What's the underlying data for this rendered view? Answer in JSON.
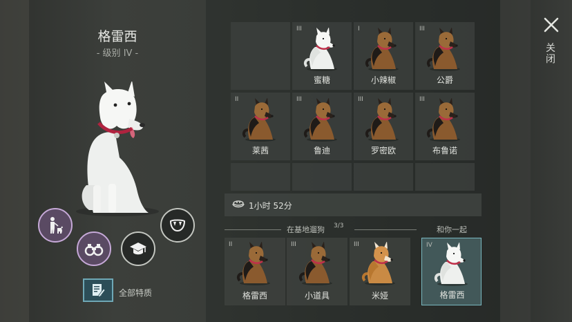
{
  "profile": {
    "name": "格雷西",
    "level": "- 级别 IV -",
    "skills": [
      {
        "icon": "walk-person-dog-icon",
        "active": true
      },
      {
        "icon": "binoculars-icon",
        "active": true
      },
      {
        "icon": "graduation-cap-icon",
        "active": false
      },
      {
        "icon": "fangs-icon",
        "active": false
      }
    ],
    "traits_label": "全部特质"
  },
  "kennel": [
    {
      "tier": "",
      "name": "",
      "coat": "empty"
    },
    {
      "tier": "III",
      "name": "蜜糖",
      "coat": "white"
    },
    {
      "tier": "I",
      "name": "小辣椒",
      "coat": "shepherd"
    },
    {
      "tier": "III",
      "name": "公爵",
      "coat": "shepherd"
    },
    {
      "tier": "II",
      "name": "莱茜",
      "coat": "shepherd"
    },
    {
      "tier": "III",
      "name": "鲁迪",
      "coat": "shepherd"
    },
    {
      "tier": "III",
      "name": "罗密欧",
      "coat": "shepherd"
    },
    {
      "tier": "III",
      "name": "布鲁诺",
      "coat": "shepherd"
    }
  ],
  "food": {
    "icon": "food-bowl-icon",
    "timer": "1小时 52分"
  },
  "walking": {
    "title": "在基地遛狗",
    "count": "3/3",
    "dogs": [
      {
        "tier": "II",
        "name": "格雷西",
        "coat": "shepherd"
      },
      {
        "tier": "III",
        "name": "小道具",
        "coat": "shepherd"
      },
      {
        "tier": "III",
        "name": "米娅",
        "coat": "shiba"
      }
    ]
  },
  "with_you": {
    "label": "和你一起",
    "tier": "IV",
    "name": "格雷西",
    "coat": "white"
  },
  "close": {
    "label": "关闭"
  },
  "colors": {
    "accent_purple": "#c6a9d8",
    "accent_teal": "#79b8c0",
    "collar_red": "#c0304a",
    "collar_blue": "#3a5fb0"
  }
}
